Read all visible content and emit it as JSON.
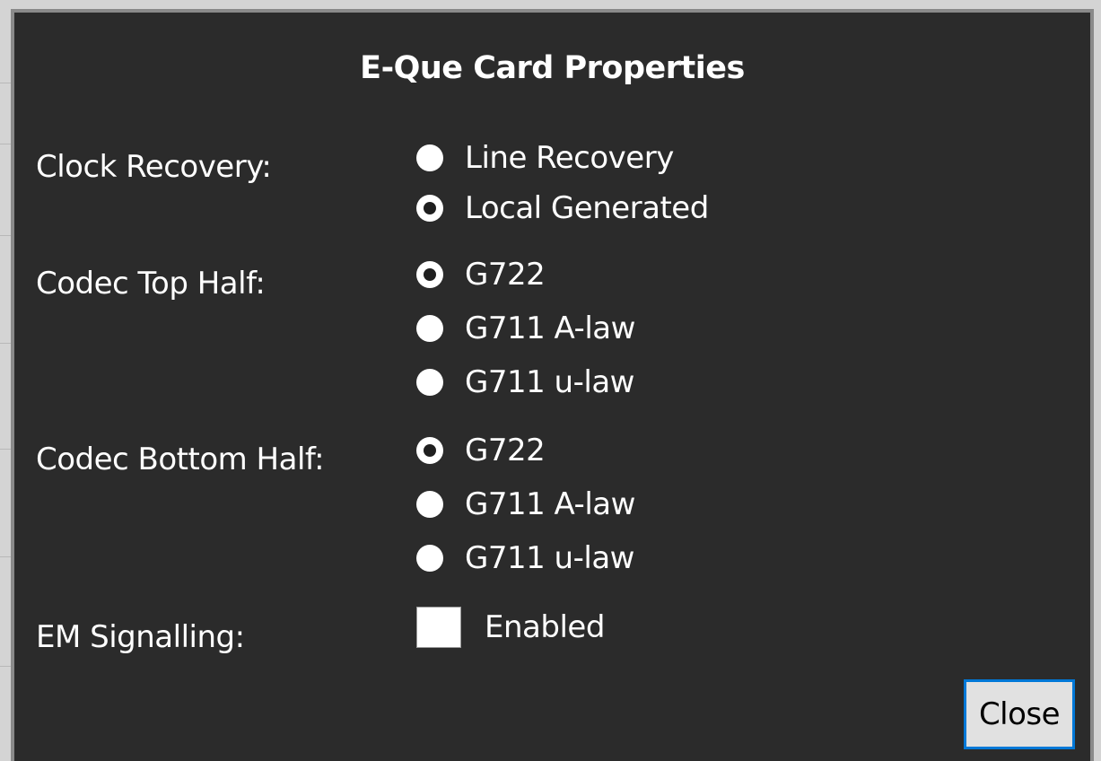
{
  "dialog": {
    "title": "E-Que Card Properties",
    "colors": {
      "background": "#2b2b2b",
      "text": "#ffffff",
      "button_border": "#0078d7",
      "button_background": "#e1e1e1"
    }
  },
  "clock_recovery": {
    "label": "Clock Recovery:",
    "options": [
      {
        "label": "Line Recovery",
        "selected": false
      },
      {
        "label": "Local Generated",
        "selected": true
      }
    ]
  },
  "codec_top_half": {
    "label": "Codec Top Half:",
    "options": [
      {
        "label": "G722",
        "selected": true
      },
      {
        "label": "G711 A-law",
        "selected": false
      },
      {
        "label": "G711 u-law",
        "selected": false
      }
    ]
  },
  "codec_bottom_half": {
    "label": "Codec Bottom Half:",
    "options": [
      {
        "label": "G722",
        "selected": true
      },
      {
        "label": "G711 A-law",
        "selected": false
      },
      {
        "label": "G711 u-law",
        "selected": false
      }
    ]
  },
  "em_signalling": {
    "label": "EM Signalling:",
    "checkbox_label": "Enabled",
    "checked": false
  },
  "buttons": {
    "close_label": "Close"
  }
}
